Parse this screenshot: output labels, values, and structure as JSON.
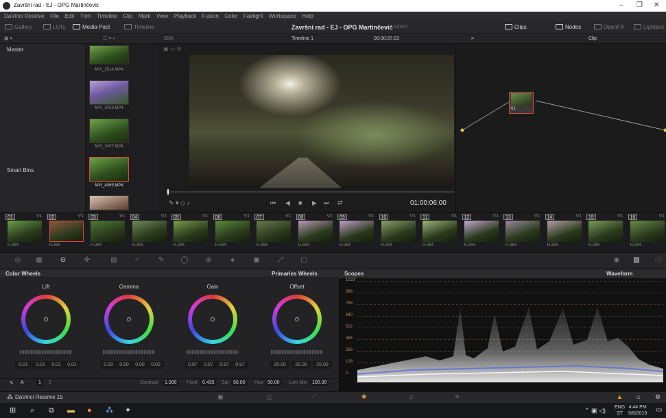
{
  "window": {
    "title": "Završni rad - EJ - OPG Martinčević",
    "minimize": "–",
    "maximize": "❐",
    "close": "✕"
  },
  "menu": [
    "DaVinci Resolve",
    "File",
    "Edit",
    "Trim",
    "Timeline",
    "Clip",
    "Mark",
    "View",
    "Playback",
    "Fusion",
    "Color",
    "Fairlight",
    "Workspace",
    "Help"
  ],
  "toolbar": {
    "gallery": "Gallery",
    "luts": "LUTs",
    "media_pool": "Media Pool",
    "timeline": "Timeline",
    "project_title": "Završni rad - EJ - OPG Martinčević",
    "project_state": "Edited",
    "clips": "Clips",
    "nodes": "Nodes",
    "openfx": "OpenFX",
    "lightbox": "Lightbox"
  },
  "subbar": {
    "zoom": "31%",
    "timeline_name": "Timeline 1",
    "timecode": "00:00:37:23",
    "clip_mode": "Clip"
  },
  "bins": {
    "master": "Master",
    "smart_bins": "Smart Bins"
  },
  "media_clips": [
    {
      "name": "MVI_3514.MP4",
      "selected": false
    },
    {
      "name": "MVI_3453.MP4",
      "selected": false
    },
    {
      "name": "MVI_3457.MP4",
      "selected": false
    },
    {
      "name": "MVI_4065.MP4",
      "selected": true
    }
  ],
  "viewer": {
    "timecode": "01:00:06:00"
  },
  "node": {
    "label": "01"
  },
  "timeline_clips": [
    {
      "num": "01",
      "track": "V1",
      "codec": "H.264"
    },
    {
      "num": "02",
      "track": "V1",
      "codec": "H.264"
    },
    {
      "num": "03",
      "track": "V1",
      "codec": "H.264"
    },
    {
      "num": "04",
      "track": "V1",
      "codec": "H.264"
    },
    {
      "num": "05",
      "track": "V1",
      "codec": "H.264"
    },
    {
      "num": "06",
      "track": "V1",
      "codec": "H.264"
    },
    {
      "num": "07",
      "track": "V1",
      "codec": "H.264"
    },
    {
      "num": "08",
      "track": "V1",
      "codec": "H.264"
    },
    {
      "num": "09",
      "track": "V1",
      "codec": "H.264"
    },
    {
      "num": "10",
      "track": "V1",
      "codec": "H.264"
    },
    {
      "num": "11",
      "track": "V1",
      "codec": "H.264"
    },
    {
      "num": "12",
      "track": "V1",
      "codec": "H.264"
    },
    {
      "num": "13",
      "track": "V1",
      "codec": "H.264"
    },
    {
      "num": "14",
      "track": "V1",
      "codec": "H.264"
    },
    {
      "num": "15",
      "track": "V1",
      "codec": "H.264"
    },
    {
      "num": "16",
      "track": "V1",
      "codec": "H.264"
    }
  ],
  "color_wheels": {
    "panel_title": "Color Wheels",
    "mode": "Primaries Wheels",
    "lift": {
      "label": "Lift",
      "values": [
        "0.01",
        "0.01",
        "0.01",
        "0.01"
      ]
    },
    "gamma": {
      "label": "Gamma",
      "values": [
        "0.00",
        "0.00",
        "0.00",
        "0.00"
      ]
    },
    "gain": {
      "label": "Gain",
      "values": [
        "0.97",
        "0.97",
        "0.97",
        "0.97"
      ]
    },
    "offset": {
      "label": "Offset",
      "values": [
        "25.00",
        "25.00",
        "25.00"
      ]
    },
    "footer": {
      "page1": "1",
      "page2": "2",
      "contrast_label": "Contrast",
      "contrast": "1.000",
      "pivot_label": "Pivot",
      "pivot": "0.435",
      "sat_label": "Sat",
      "sat": "50.00",
      "hue_label": "Hue",
      "hue": "50.00",
      "lummix_label": "Lum Mix",
      "lummix": "100.00"
    }
  },
  "scopes": {
    "title": "Scopes",
    "mode": "Waveform",
    "ticks": [
      "1023",
      "896",
      "768",
      "640",
      "512",
      "384",
      "256",
      "128",
      "0"
    ]
  },
  "pagebar": {
    "app_name": "DaVinci Resolve 15"
  },
  "taskbar": {
    "lang1": "ENG",
    "lang2": "ST",
    "time": "4:44 PM",
    "date": "9/6/2019"
  }
}
